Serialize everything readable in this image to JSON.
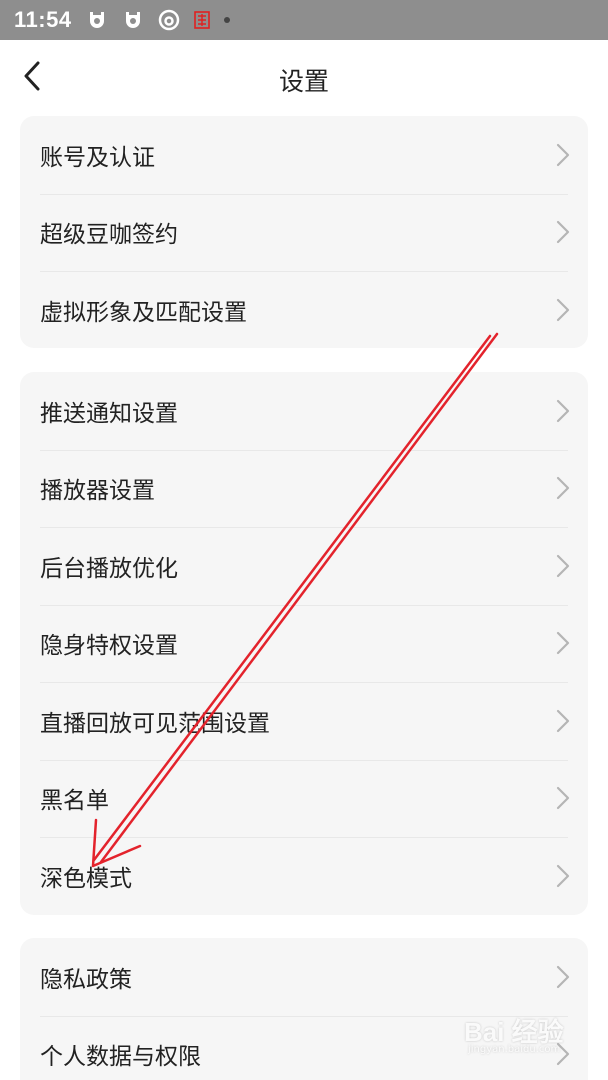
{
  "status": {
    "time": "11:54",
    "icons": [
      "notification-icon",
      "notification-icon",
      "netease-music-icon",
      "app-badge-icon",
      "dot-icon"
    ],
    "badge_color": "#e02020"
  },
  "header": {
    "title": "设置",
    "back_icon": "chevron-left-icon"
  },
  "groups": {
    "account": {
      "items": [
        {
          "label": "账号及认证"
        },
        {
          "label": "超级豆咖签约"
        },
        {
          "label": "虚拟形象及匹配设置"
        }
      ]
    },
    "general": {
      "items": [
        {
          "label": "推送通知设置"
        },
        {
          "label": "播放器设置"
        },
        {
          "label": "后台播放优化"
        },
        {
          "label": "隐身特权设置"
        },
        {
          "label": "直播回放可见范围设置"
        },
        {
          "label": "黑名单"
        },
        {
          "label": "深色模式"
        }
      ]
    },
    "privacy": {
      "items": [
        {
          "label": "隐私政策"
        },
        {
          "label": "个人数据与权限"
        }
      ]
    }
  },
  "annotation": {
    "color": "#e3232c",
    "target": "深色模式"
  },
  "watermark": {
    "main": "Bai 经验",
    "sub": "jingyan.baidu.com"
  },
  "colors": {
    "background": "#ffffff",
    "card": "#f6f6f6",
    "status_bar": "#8e8e8e",
    "text": "#222222",
    "chevron": "#b5b5b5"
  }
}
